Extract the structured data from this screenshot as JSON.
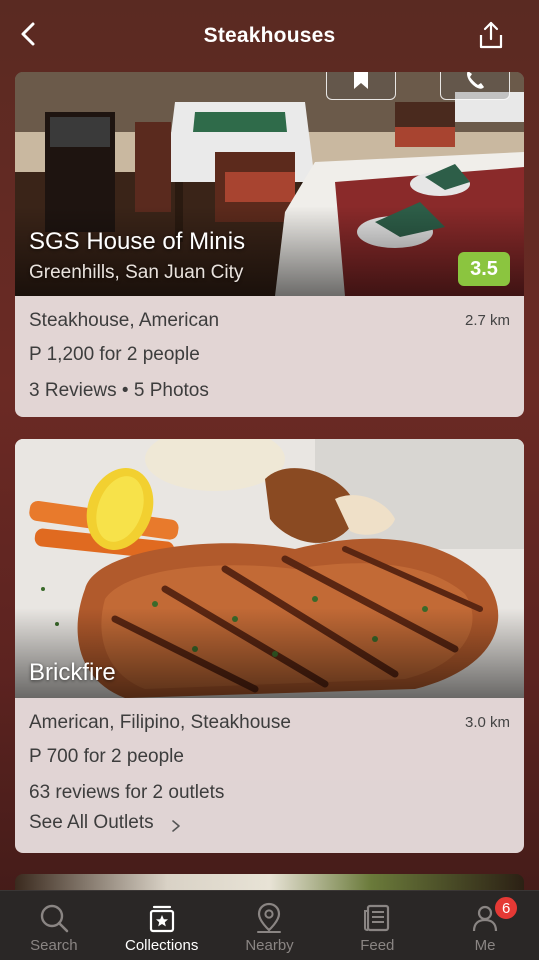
{
  "header": {
    "title": "Steakhouses",
    "back_icon": "chevron-left-icon",
    "share_icon": "share-icon"
  },
  "restaurants": [
    {
      "name": "SGS House of Minis",
      "location": "Greenhills, San Juan City",
      "rating": "3.5",
      "rating_color": "#8bc53f",
      "cuisine": "Steakhouse, American",
      "distance": "2.7 km",
      "cost": "P 1,200 for 2 people",
      "reviews": "3 Reviews • 5 Photos",
      "photo": "restaurant-interior-photo"
    },
    {
      "name": "Brickfire",
      "cuisine": "American, Filipino, Steakhouse",
      "distance": "3.0 km",
      "cost": "P 700 for 2 people",
      "reviews": "63 reviews for 2 outlets",
      "outlets_link": "See All Outlets",
      "photo": "grilled-steak-photo"
    }
  ],
  "tabbar": {
    "tabs": [
      {
        "label": "Search",
        "icon": "search-icon"
      },
      {
        "label": "Collections",
        "icon": "collections-icon",
        "active": true
      },
      {
        "label": "Nearby",
        "icon": "location-pin-icon"
      },
      {
        "label": "Feed",
        "icon": "feed-icon"
      },
      {
        "label": "Me",
        "icon": "profile-icon",
        "badge": "6"
      }
    ]
  },
  "colors": {
    "active_tab": "#ffffff",
    "inactive_tab": "#8a8583",
    "badge": "#e53935"
  }
}
